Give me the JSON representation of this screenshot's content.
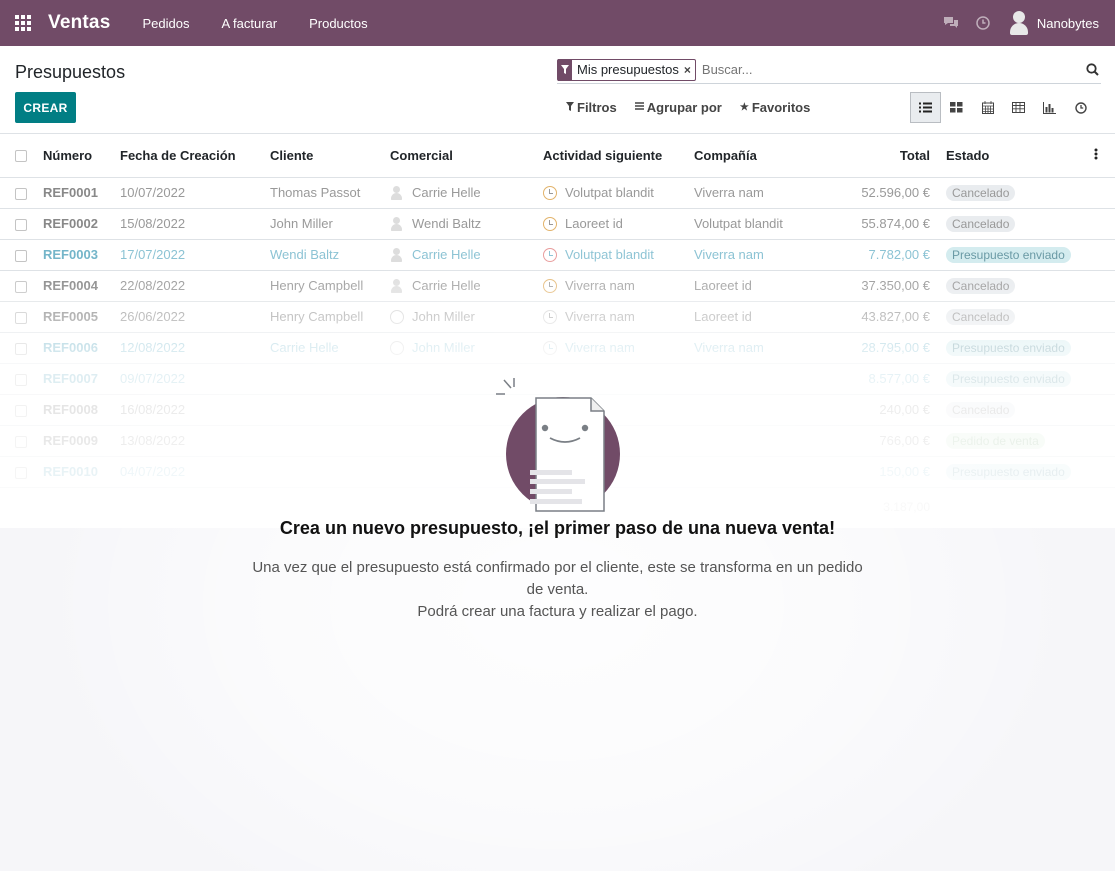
{
  "navbar": {
    "app_name": "Ventas",
    "menu": [
      "Pedidos",
      "A facturar",
      "Productos"
    ],
    "user": "Nanobytes"
  },
  "control": {
    "title": "Presupuestos",
    "create_label": "CREAR",
    "facet_label": "Mis presupuestos",
    "search_placeholder": "Buscar...",
    "filters_label": "Filtros",
    "group_label": "Agrupar por",
    "favorites_label": "Favoritos"
  },
  "table": {
    "columns": [
      "Número",
      "Fecha de Creación",
      "Cliente",
      "Comercial",
      "Actividad siguiente",
      "Compañía",
      "Total",
      "Estado"
    ],
    "rows": [
      {
        "num": "REF0001",
        "date": "10/07/2022",
        "client": "Thomas Passot",
        "sales": "Carrie Helle",
        "activity": "Volutpat blandit",
        "company": "Viverra nam",
        "total": "52.596,00 €",
        "state": "Cancelado"
      },
      {
        "num": "REF0002",
        "date": "15/08/2022",
        "client": "John Miller",
        "sales": "Wendi Baltz",
        "activity": "Laoreet id",
        "company": "Volutpat blandit",
        "total": "55.874,00 €",
        "state": "Cancelado"
      },
      {
        "num": "REF0003",
        "date": "17/07/2022",
        "client": "Wendi Baltz",
        "sales": "Carrie Helle",
        "activity": "Volutpat blandit",
        "company": "Viverra nam",
        "total": "7.782,00 €",
        "state": "Presupuesto enviado"
      },
      {
        "num": "REF0004",
        "date": "22/08/2022",
        "client": "Henry Campbell",
        "sales": "Carrie Helle",
        "activity": "Viverra nam",
        "company": "Laoreet id",
        "total": "37.350,00 €",
        "state": "Cancelado"
      },
      {
        "num": "REF0005",
        "date": "26/06/2022",
        "client": "Henry Campbell",
        "sales": "John Miller",
        "activity": "Viverra nam",
        "company": "Laoreet id",
        "total": "43.827,00 €",
        "state": "Cancelado"
      },
      {
        "num": "REF0006",
        "date": "12/08/2022",
        "client": "Carrie Helle",
        "sales": "John Miller",
        "activity": "Viverra nam",
        "company": "Viverra nam",
        "total": "28.795,00 €",
        "state": "Presupuesto enviado"
      },
      {
        "num": "REF0007",
        "date": "09/07/2022",
        "client": "",
        "sales": "",
        "activity": "",
        "company": "",
        "total": "8.577,00 €",
        "state": "Presupuesto enviado"
      },
      {
        "num": "REF0008",
        "date": "16/08/2022",
        "client": "",
        "sales": "",
        "activity": "",
        "company": "",
        "total": "240,00 €",
        "state": "Cancelado"
      },
      {
        "num": "REF0009",
        "date": "13/08/2022",
        "client": "",
        "sales": "",
        "activity": "",
        "company": "",
        "total": "766,00 €",
        "state": "Pedido de venta"
      },
      {
        "num": "REF0010",
        "date": "04/07/2022",
        "client": "",
        "sales": "",
        "activity": "",
        "company": "",
        "total": "150,00 €",
        "state": "Presupuesto enviado"
      }
    ],
    "sum_total": "3.187,00"
  },
  "help": {
    "title": "Crea un nuevo presupuesto, ¡el primer paso de una nueva venta!",
    "line1": "Una vez que el presupuesto está confirmado por el cliente, este se transforma en un pedido de venta.",
    "line2": "Podrá crear una factura y realizar el pago."
  },
  "colors": {
    "brand": "#714b67",
    "primary_button": "#017e84"
  }
}
